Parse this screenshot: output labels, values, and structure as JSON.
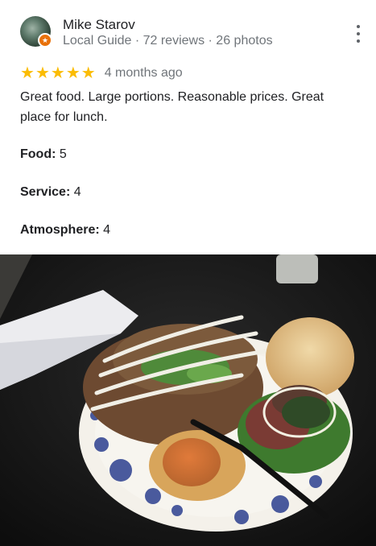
{
  "reviewer": {
    "name": "Mike Starov",
    "meta": "Local Guide · 72 reviews · 26 photos",
    "avatar_icon": "avatar-succulent-photo",
    "badge_icon": "local-guide-star-icon"
  },
  "more_options_icon": "more-vert-icon",
  "rating": {
    "stars": 5,
    "max": 5,
    "star_glyph": "★",
    "time_ago": "4 months ago"
  },
  "review": {
    "text": "Great food. Large portions. Reasonable prices. Great place for lunch."
  },
  "attributes": [
    {
      "label": "Food:",
      "value": "5"
    },
    {
      "label": "Service:",
      "value": "4"
    },
    {
      "label": "Atmosphere:",
      "value": "4"
    }
  ],
  "photo": {
    "subject": "gyro-plate-photo"
  },
  "colors": {
    "star": "#fbbc04",
    "badge": "#e8710a",
    "secondary_text": "#70757a"
  }
}
